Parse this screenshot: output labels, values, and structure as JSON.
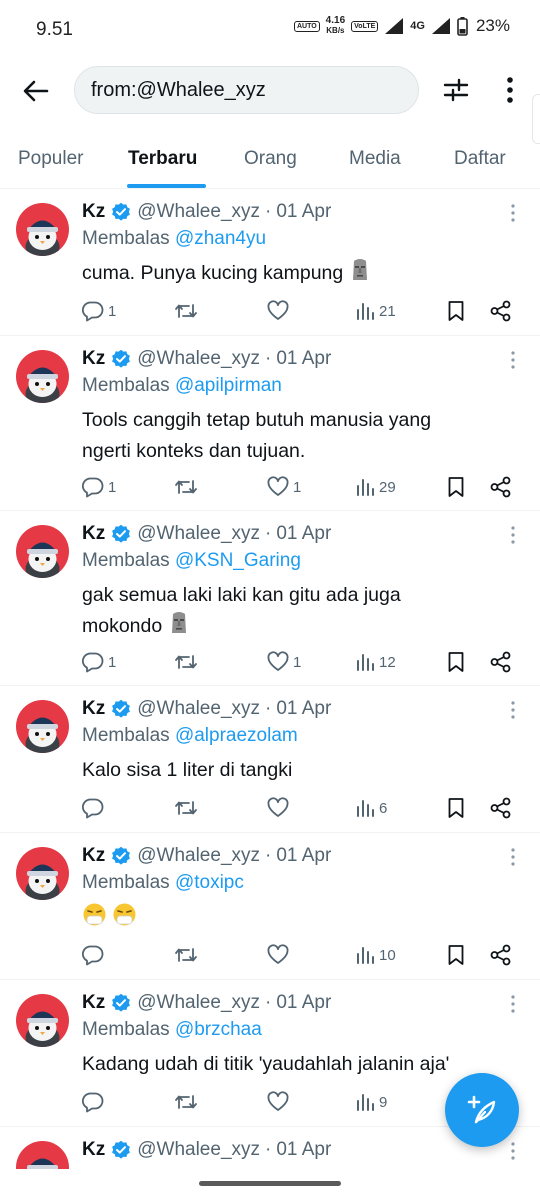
{
  "status_bar": {
    "time": "9.51",
    "net_speed_value": "4.16",
    "net_speed_unit": "KB/s",
    "battery": "23%",
    "network": "4G"
  },
  "search": {
    "query": "from:@Whalee_xyz"
  },
  "tabs": [
    {
      "label": "Populer",
      "active": false
    },
    {
      "label": "Terbaru",
      "active": true
    },
    {
      "label": "Orang",
      "active": false
    },
    {
      "label": "Media",
      "active": false
    },
    {
      "label": "Daftar",
      "active": false
    }
  ],
  "colors": {
    "accent": "#1d9bf0",
    "text": "#0f1419",
    "muted": "#536471",
    "avatar_bg": "#e53946"
  },
  "author": {
    "name": "Kz",
    "handle": "@Whalee_xyz",
    "verified": true
  },
  "reply_prefix": "Membalas",
  "tweets": [
    {
      "date": "01 Apr",
      "reply_to": "@zhan4yu",
      "lines": [
        "cuma. Punya kucing kampung"
      ],
      "emoji": "moai",
      "replies": "1",
      "retweets": "",
      "likes": "",
      "views": "21"
    },
    {
      "date": "01 Apr",
      "reply_to": "@apilpirman",
      "lines": [
        "Tools canggih tetap butuh manusia yang",
        "ngerti konteks dan tujuan."
      ],
      "emoji": "",
      "replies": "1",
      "retweets": "",
      "likes": "1",
      "views": "29"
    },
    {
      "date": "01 Apr",
      "reply_to": "@KSN_Garing",
      "lines": [
        "gak semua laki laki kan gitu ada juga",
        "mokondo"
      ],
      "emoji": "moai",
      "replies": "1",
      "retweets": "",
      "likes": "1",
      "views": "12"
    },
    {
      "date": "01 Apr",
      "reply_to": "@alpraezolam",
      "lines": [
        "Kalo sisa 1 liter di tangki"
      ],
      "emoji": "",
      "replies": "",
      "retweets": "",
      "likes": "",
      "views": "6"
    },
    {
      "date": "01 Apr",
      "reply_to": "@toxipc",
      "lines": [
        ""
      ],
      "emoji": "sneezing-face x2",
      "replies": "",
      "retweets": "",
      "likes": "",
      "views": "10"
    },
    {
      "date": "01 Apr",
      "reply_to": "@brzchaa",
      "lines": [
        "Kadang udah di titik 'yaudahlah jalanin aja'"
      ],
      "emoji": "",
      "replies": "",
      "retweets": "",
      "likes": "",
      "views": "9"
    },
    {
      "date": "01 Apr",
      "reply_to": "",
      "lines": [],
      "emoji": "",
      "replies": "",
      "retweets": "",
      "likes": "",
      "views": ""
    }
  ],
  "icons": {
    "back": "arrow-left-icon",
    "filter": "sliders-icon",
    "more": "more-vertical-icon",
    "verified": "verified-badge-icon",
    "reply": "reply-icon",
    "retweet": "retweet-icon",
    "like": "heart-icon",
    "views": "views-chart-icon",
    "bookmark": "bookmark-icon",
    "share": "share-icon",
    "compose": "compose-icon"
  }
}
